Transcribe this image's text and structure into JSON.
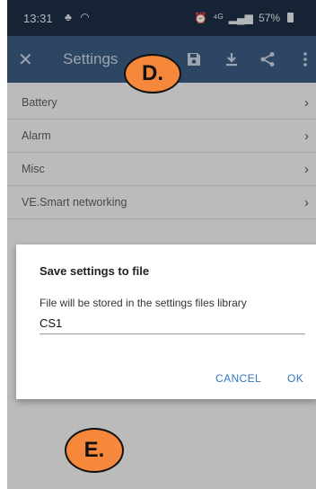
{
  "status_bar": {
    "time": "13:31",
    "left_icons": "♣ ◠",
    "alarm_icon": "⏰",
    "network": "⁴ᴳ",
    "signal": "▂▄▆",
    "battery": "57%"
  },
  "app_bar": {
    "close_label": "✕",
    "title": "Settings",
    "icons": [
      "save-icon",
      "download-icon",
      "share-icon",
      "more-vert-icon"
    ]
  },
  "list": {
    "items": [
      {
        "label": "Battery",
        "chevron": "›"
      },
      {
        "label": "Alarm",
        "chevron": "›"
      },
      {
        "label": "Misc",
        "chevron": "›"
      },
      {
        "label": "VE.Smart networking",
        "chevron": "›"
      }
    ]
  },
  "dialog": {
    "title": "Save settings to file",
    "message": "File will be stored in the settings files library",
    "input_value": "CS1",
    "cancel_label": "CANCEL",
    "ok_label": "OK"
  },
  "callouts": {
    "d": "D.",
    "e": "E."
  },
  "colors": {
    "status_bar": "#1b2e45",
    "app_bar": "#3a5a80",
    "accent": "#2e78c0",
    "callout": "#f5883a"
  }
}
